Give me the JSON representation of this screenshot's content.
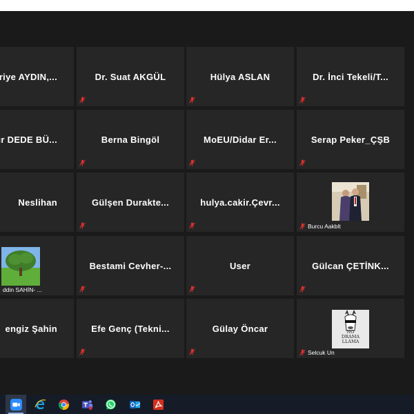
{
  "participants": [
    {
      "name": "riye  AYDIN,...",
      "muted": true
    },
    {
      "name": "Dr. Suat AKGÜL",
      "muted": true
    },
    {
      "name": "Hülya ASLAN",
      "muted": true
    },
    {
      "name": "Dr. İnci Tekeli/T...",
      "muted": true
    },
    {
      "name": "ur  DEDE BÜ...",
      "muted": true
    },
    {
      "name": "Berna Bingöl",
      "muted": true
    },
    {
      "name": "MoEU/Didar  Er...",
      "muted": true
    },
    {
      "name": "Serap Peker_ÇŞB",
      "muted": true
    },
    {
      "name": "Neslihan",
      "muted": true
    },
    {
      "name": "Gülşen  Durakte...",
      "muted": true
    },
    {
      "name": "hulya.cakir.Çevr...",
      "muted": true
    },
    {
      "name": "Burcu Aakblt",
      "muted": true,
      "video": "couple-photo"
    },
    {
      "name": "ddin SAHİN- ...",
      "muted": false,
      "video": "tree-photo"
    },
    {
      "name": "Bestami  Cevher-...",
      "muted": true
    },
    {
      "name": "User",
      "muted": true
    },
    {
      "name": "Gülcan  ÇETİNK...",
      "muted": true
    },
    {
      "name": "engiz Şahin",
      "muted": true
    },
    {
      "name": "Efe Genç  (Tekni...",
      "muted": true
    },
    {
      "name": "Gülay Öncar",
      "muted": true
    },
    {
      "name": "Selcuk Un",
      "muted": true,
      "video": "no-drama-llama-logo"
    }
  ],
  "llama_logo_text": "NO DRAMA LLAMA",
  "colors": {
    "meeting_bg": "#1a1a1a",
    "tile_bg": "#262626",
    "mute_icon": "#e0312f",
    "taskbar_bg": "#151c28"
  },
  "taskbar": {
    "apps": [
      "zoom-icon",
      "internet-explorer-icon",
      "chrome-icon",
      "teams-icon",
      "whatsapp-icon",
      "outlook-icon",
      "acrobat-icon"
    ],
    "active_app": "zoom-icon"
  }
}
